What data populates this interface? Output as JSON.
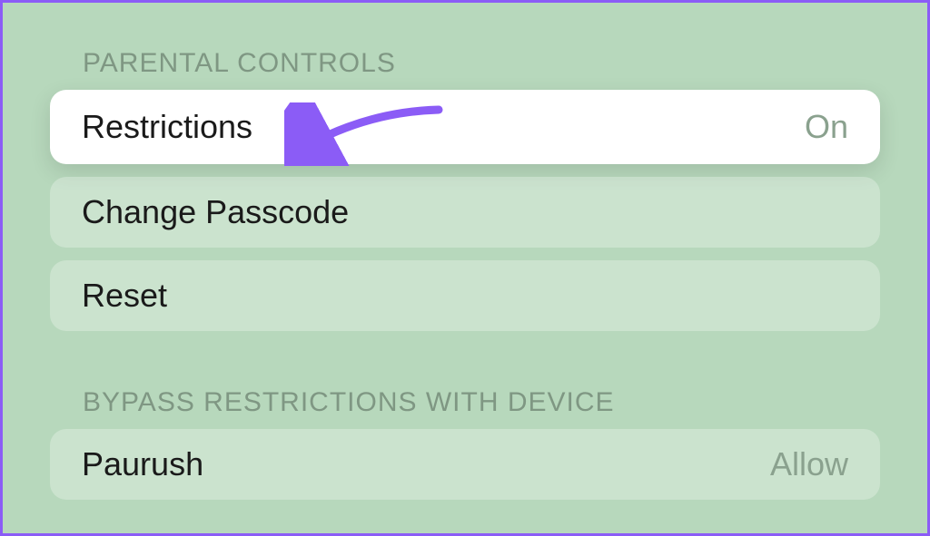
{
  "sections": {
    "parental": {
      "header": "PARENTAL CONTROLS",
      "restrictions": {
        "label": "Restrictions",
        "value": "On"
      },
      "changePasscode": {
        "label": "Change Passcode"
      },
      "reset": {
        "label": "Reset"
      }
    },
    "bypass": {
      "header": "BYPASS RESTRICTIONS WITH DEVICE",
      "device": {
        "label": "Paurush",
        "value": "Allow"
      }
    }
  },
  "annotation": {
    "arrowColor": "#8b5cf6"
  }
}
